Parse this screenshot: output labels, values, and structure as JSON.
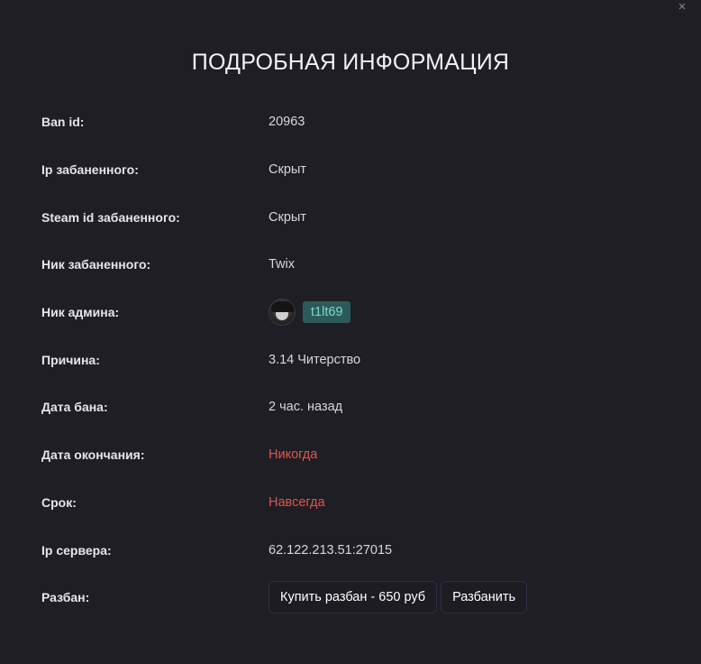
{
  "modal": {
    "close_glyph": "×",
    "title": "ПОДРОБНАЯ ИНФОРМАЦИЯ"
  },
  "details": {
    "ban_id": {
      "label": "Ban id:",
      "value": "20963"
    },
    "ip": {
      "label": "Ip забаненного:",
      "value": "Скрыт"
    },
    "steam_id": {
      "label": "Steam id забаненного:",
      "value": "Скрыт"
    },
    "nick": {
      "label": "Ник забаненного:",
      "value": "Twix"
    },
    "admin": {
      "label": "Ник админа:",
      "value": "t1lt69"
    },
    "reason": {
      "label": "Причина:",
      "value": "3.14 Читерство"
    },
    "ban_date": {
      "label": "Дата бана:",
      "value": "2 час. назад"
    },
    "end_date": {
      "label": "Дата окончания:",
      "value": "Никогда"
    },
    "term": {
      "label": "Срок:",
      "value": "Навсегда"
    },
    "server_ip": {
      "label": "Ip сервера:",
      "value": "62.122.213.51:27015"
    },
    "unban": {
      "label": "Разбан:",
      "buy_button": "Купить разбан - 650 руб",
      "unban_button": "Разбанить"
    }
  },
  "colors": {
    "background": "#1f1e24",
    "label_text": "#e6e6ea",
    "value_text": "#d7d7dc",
    "danger_text": "#e05552",
    "admin_tag_bg": "#2c5a58",
    "admin_tag_text": "#7ed9cf",
    "button_border": "#2e2e4a"
  }
}
